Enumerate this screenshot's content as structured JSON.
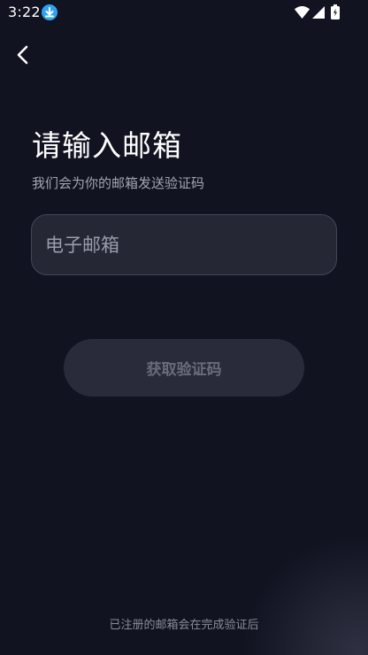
{
  "status_bar": {
    "time": "3:22",
    "icons": [
      "download-icon",
      "wifi-icon",
      "signal-icon",
      "battery-icon"
    ]
  },
  "header": {
    "back_icon": "chevron-left-icon"
  },
  "main": {
    "title": "请输入邮箱",
    "subtitle": "我们会为你的邮箱发送验证码",
    "email_placeholder": "电子邮箱",
    "email_value": "",
    "get_code_label": "获取验证码"
  },
  "footer": {
    "note": "已注册的邮箱会在完成验证后"
  },
  "colors": {
    "background": "#121321",
    "input_bg": "#262735",
    "button_bg": "#2a2b3a",
    "button_text": "#6a6b7a",
    "accent_download": "#2fa3f2"
  }
}
